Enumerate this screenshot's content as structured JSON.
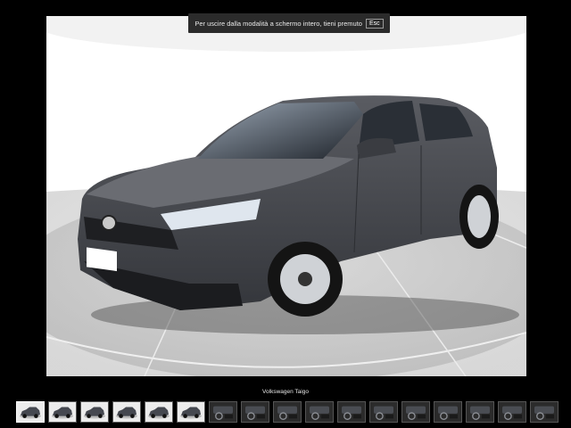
{
  "fullscreen_notice": {
    "text": "Per uscire dalla modalità a schermo intero, tieni premuto",
    "key": "Esc"
  },
  "gallery": {
    "caption": "Volkswagen Taigo",
    "main_image": "car-photo",
    "thumbnails": [
      {
        "type": "exterior"
      },
      {
        "type": "exterior"
      },
      {
        "type": "exterior"
      },
      {
        "type": "exterior"
      },
      {
        "type": "exterior"
      },
      {
        "type": "exterior"
      },
      {
        "type": "interior"
      },
      {
        "type": "interior"
      },
      {
        "type": "interior"
      },
      {
        "type": "interior"
      },
      {
        "type": "interior"
      },
      {
        "type": "interior"
      },
      {
        "type": "interior"
      },
      {
        "type": "interior"
      },
      {
        "type": "interior"
      },
      {
        "type": "interior"
      },
      {
        "type": "interior"
      }
    ]
  }
}
